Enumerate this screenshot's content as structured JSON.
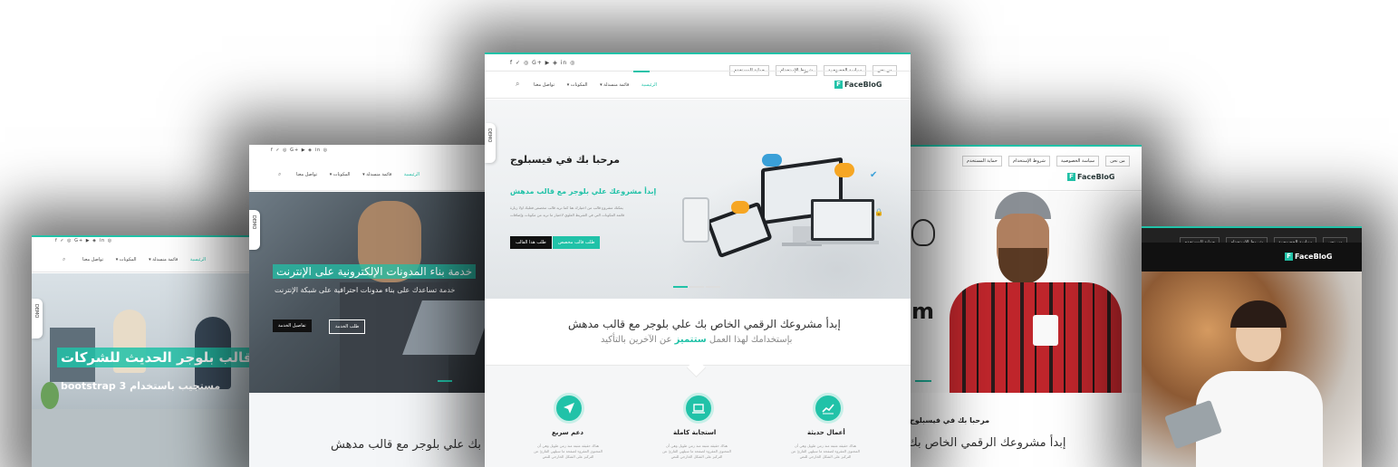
{
  "social_icons": "f ✓ ◎ G+ ▶ ◈ in ◎",
  "top_links": [
    "من نحن",
    "سياسة الخصوصية",
    "شروط الإستخدام",
    "حماية المستخدم"
  ],
  "nav": {
    "home": "الرئيسية",
    "multi": "قائمة منسدلة ▾",
    "components": "المكونات ▾",
    "contact": "تواصل معنا"
  },
  "brand": "FaceBloG",
  "demo_label": "DEMO",
  "center": {
    "hero_title": "مرحبا بك في فيسبلوج",
    "hero_subtitle": "إبدأ مشروعك علي بلوجر مع قالب مدهش",
    "hero_desc_1": "يمكنك مشروع قالب من اختيارك هنا كما تريد قالب مخصص فعليك اولا زيارة",
    "hero_desc_2": "قائمة المكونات التي في الشريط العلوي لاختيار ما تريد من مكونات وإضافات",
    "btn_custom": "طلب قالب مخصص",
    "btn_order": "طلب هذا القالب",
    "section_title": "إبدأ مشروعك الرقمي الخاص بك علي بلوجر مع قالب مدهش",
    "section_sub_pre": "بإستخدامك لهذا العمل",
    "section_sub_em": "ستتميز",
    "section_sub_post": "عن الآخرين بالتأكيد",
    "features": [
      {
        "title": "أعمال حديثة",
        "desc": "هناك حقيقة مثبتة منذ زمن طويل وهي أن المحتوى المقروء لصفحة ما سيلهي القارئ عن التركيز على الشكل الخارجي للنص"
      },
      {
        "title": "استجابة كاملة",
        "desc": "هناك حقيقة مثبتة منذ زمن طويل وهي أن المحتوى المقروء لصفحة ما سيلهي القارئ عن التركيز على الشكل الخارجي للنص"
      },
      {
        "title": "دعم سريع",
        "desc": "هناك حقيقة مثبتة منذ زمن طويل وهي أن المحتوى المقروء لصفحة ما سيلهي القارئ عن التركيز على الشكل الخارجي للنص"
      }
    ]
  },
  "left2": {
    "hero_title": "خدمة بناء المدونات الإلكترونية على الإنترنت",
    "hero_sub": "خدمة تساعدك على بناء مدونات احترافية على شبكة الإنترنت",
    "btn_request": "طلب الخدمة",
    "btn_details": "تفاصيل الخدمة",
    "bottom_text": "إبدأ مشروعك الرقمي الخاص بك علي بلوجر مع قالب مدهش"
  },
  "left1": {
    "hero_title": "قالب بلوجر الحديث للشركات",
    "hero_sub": "مستجيب باستخدام bootstrap 3"
  },
  "right1": {
    "hero_title": "مرحبا بك في فيسبلوج",
    "bottom_text": "إبدأ مشروعك الرقمي الخاص بك"
  },
  "right2": {}
}
